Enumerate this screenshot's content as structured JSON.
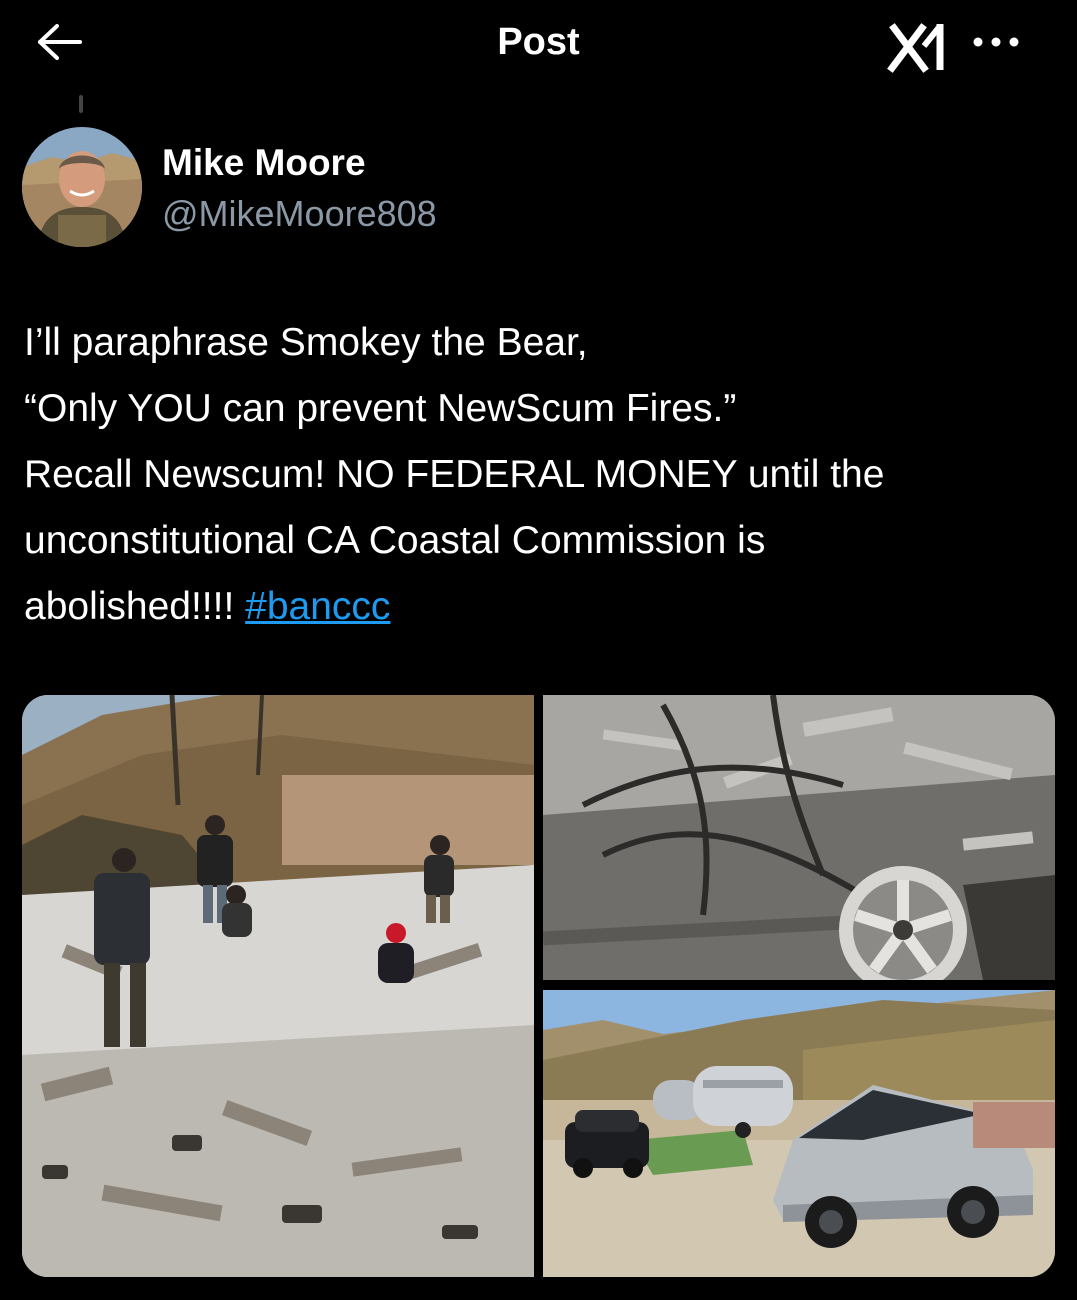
{
  "header": {
    "title": "Post",
    "back_icon": "arrow-left-icon",
    "grok_icon": "grok-icon",
    "more_icon": "more-horizontal-icon"
  },
  "author": {
    "name": "Mike Moore",
    "handle": "@MikeMoore808"
  },
  "post": {
    "lines": [
      "I’ll paraphrase Smokey the Bear,",
      "“Only YOU can prevent NewScum Fires.”",
      "Recall Newscum! NO FEDERAL MONEY until the",
      "unconstitutional CA Coastal Commission is"
    ],
    "last_line_text": "abolished!!!! ",
    "hashtag": "#banccc"
  },
  "colors": {
    "background": "#000000",
    "text": "#ffffff",
    "secondary_text": "#8b98a5",
    "link": "#1d9bf0"
  }
}
